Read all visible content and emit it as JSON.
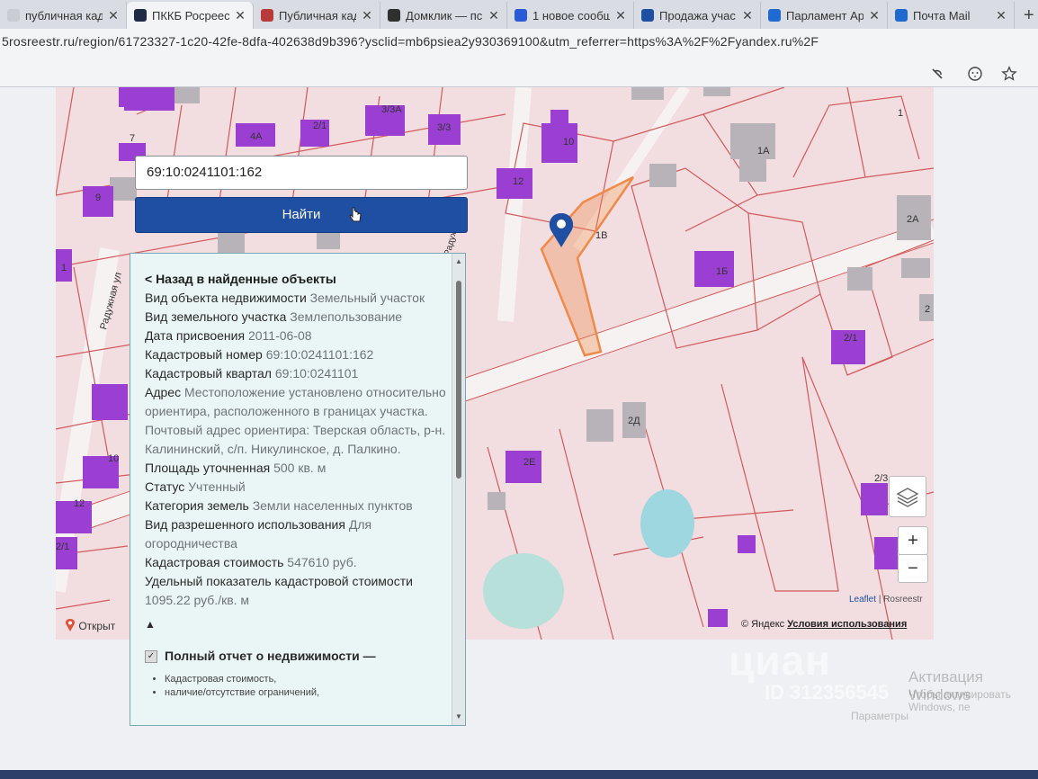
{
  "browser": {
    "tabs": [
      {
        "title": "публичная кад",
        "active": false,
        "favicon_color": "#c9ccd2"
      },
      {
        "title": "ПККБ Росреест",
        "active": true,
        "favicon_color": "#1f2a44"
      },
      {
        "title": "Публичная кад",
        "active": false,
        "favicon_color": "#b83a3a"
      },
      {
        "title": "Домклик — пс",
        "active": false,
        "favicon_color": "#2f2f2f"
      },
      {
        "title": "1 новое сообщ",
        "active": false,
        "favicon_color": "#2a5bd7"
      },
      {
        "title": "Продажа учас",
        "active": false,
        "favicon_color": "#1f4fa3"
      },
      {
        "title": "Парламент Ар",
        "active": false,
        "favicon_color": "#1e6ad1"
      },
      {
        "title": "Почта Mail",
        "active": false,
        "favicon_color": "#1e6ad1"
      }
    ],
    "close_glyph": "✕",
    "new_tab_glyph": "+",
    "url": "5rosreestr.ru/region/61723327-1c20-42fe-8dfa-402638d9b396?ysclid=mb6psiea2y930369100&utm_referrer=https%3A%2F%2Fyandex.ru%2F",
    "icons": [
      "incognito-icon",
      "emoji-icon",
      "favorites-icon"
    ]
  },
  "search": {
    "value": "69:10:0241101:162",
    "button_label": "Найти"
  },
  "info_panel": {
    "back_link": "< Назад в найденные объекты",
    "fields": [
      {
        "label": "Вид объекта недвижимости",
        "value": "Земельный участок"
      },
      {
        "label": "Вид земельного участка",
        "value": "Землепользование"
      },
      {
        "label": "Дата присвоения",
        "value": "2011-06-08"
      },
      {
        "label": "Кадастровый номер",
        "value": "69:10:0241101:162"
      },
      {
        "label": "Кадастровый квартал",
        "value": "69:10:0241101"
      },
      {
        "label": "Адрес",
        "value": "Местоположение установлено относительно ориентира, расположенного в границах участка. Почтовый адрес ориентира: Тверская область, р-н. Калининский, с/п. Никулинское, д. Палкино."
      },
      {
        "label": "Площадь уточненная",
        "value": "500 кв. м"
      },
      {
        "label": "Статус",
        "value": "Учтенный"
      },
      {
        "label": "Категория земель",
        "value": "Земли населенных пунктов"
      },
      {
        "label": "Вид разрешенного использования",
        "value": "Для огородничества"
      },
      {
        "label": "Кадастровая стоимость",
        "value": "547610 руб."
      },
      {
        "label": "Удельный показатель кадастровой стоимости",
        "value": "1095.22 руб./кв. м"
      }
    ],
    "toggle_glyph": "▲",
    "report_title": "Полный отчет о недвижимости —",
    "report_items": [
      "Кадастровая стоимость,",
      "наличие/отсутствие ограничений,"
    ]
  },
  "map": {
    "street_label": "Радужная ул",
    "street_label_2": "Радужная ул",
    "building_labels": [
      "4А",
      "2/1",
      "3/3А",
      "3/3",
      "10",
      "12",
      "1А",
      "1",
      "1В",
      "1Б",
      "2А",
      "2/1",
      "2Д",
      "2Е",
      "7",
      "9",
      "1",
      "10",
      "12",
      "2/1",
      "2/3",
      "2"
    ],
    "zoom_in": "+",
    "zoom_out": "−",
    "attribution_leaflet": "Leaflet",
    "attribution_separator": "|",
    "attribution_source": "Rosreestr",
    "yandex_copyright": "© Яндекс",
    "yandex_terms": "Условия использования",
    "open_link": "Открыт",
    "colors": {
      "parcel_fill": "#f2dde1",
      "parcel_border": "#d25a5a",
      "building": "#9a3fd1",
      "building_grey": "#b7b3b8",
      "selected_parcel": "#ef8a4a",
      "road": "#f7f2f2",
      "water": "#9fd7e0",
      "marker": "#1f4fa3"
    }
  },
  "watermark": {
    "brand": "циан",
    "id": "ID 312356545",
    "windows_title": "Активация Windows",
    "windows_sub": "Чтобы активировать Windows, пе",
    "windows_sub2": "Параметры"
  }
}
